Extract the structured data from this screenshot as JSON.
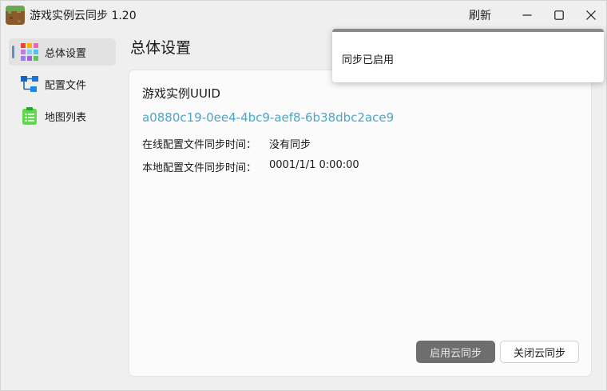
{
  "window": {
    "title": "游戏实例云同步 1.20",
    "refresh_label": "刷新"
  },
  "icons": {
    "app": "minecraft-grass-block-icon",
    "minimize": "minimize-icon",
    "maximize": "maximize-icon",
    "close": "close-icon"
  },
  "sidebar": {
    "items": [
      {
        "label": "总体设置",
        "icon": "grid-settings-icon",
        "active": true
      },
      {
        "label": "配置文件",
        "icon": "tree-structure-icon",
        "active": false
      },
      {
        "label": "地图列表",
        "icon": "clipboard-list-icon",
        "active": false
      }
    ]
  },
  "main": {
    "title": "总体设置",
    "uuid_label": "游戏实例UUID",
    "uuid_value": "a0880c19-0ee4-4bc9-aef8-6b38dbc2ace9",
    "online_sync_label": "在线配置文件同步时间：",
    "online_sync_value": "没有同步",
    "local_sync_label": "本地配置文件同步时间：",
    "local_sync_value": "0001/1/1 0:00:00",
    "enable_button": "启用云同步",
    "disable_button": "关闭云同步"
  },
  "toast": {
    "message": "同步已启用"
  },
  "colors": {
    "accent": "#5a8fc8",
    "link": "#4ba6c7",
    "primary_button": "#6e6e6e"
  }
}
